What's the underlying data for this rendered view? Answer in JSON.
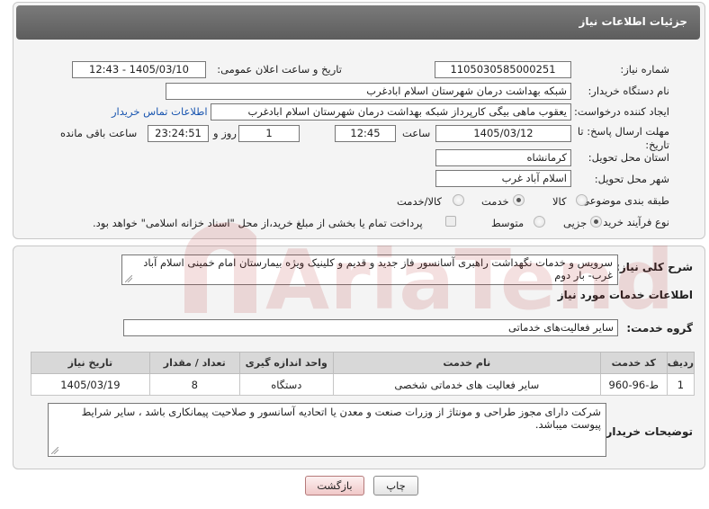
{
  "header": {
    "title": "جزئیات اطلاعات نیاز"
  },
  "fields": {
    "need_number_label": "شماره نیاز:",
    "need_number": "1105030585000251",
    "announce_datetime_label": "تاریخ و ساعت اعلان عمومی:",
    "announce_datetime": "1405/03/10 - 12:43",
    "buyer_org_label": "نام دستگاه خریدار:",
    "buyer_org": "شبکه بهداشت درمان شهرستان اسلام ابادغرب",
    "requester_label": "ایجاد کننده درخواست:",
    "requester": "یعقوب ماهی بیگی کارپرداز شبکه بهداشت درمان شهرستان اسلام ابادغرب",
    "contact_link": "اطلاعات تماس خریدار",
    "deadline_label": "مهلت ارسال پاسخ: تا تاریخ:",
    "deadline_date": "1405/03/12",
    "time_label": "ساعت",
    "deadline_time": "12:45",
    "days_value": "1",
    "days_label": "روز و",
    "remaining_time": "23:24:51",
    "remaining_label": "ساعت باقی مانده",
    "province_label": "استان محل تحویل:",
    "province": "کرمانشاه",
    "city_label": "شهر محل تحویل:",
    "city": "اسلام آباد غرب",
    "category_label": "طبقه بندی موضوعی:",
    "category_options": [
      "کالا",
      "خدمت",
      "کالا/خدمت"
    ],
    "category_selected": "خدمت",
    "process_label": "نوع فرآیند خرید :",
    "process_options": [
      "جزیی",
      "متوسط"
    ],
    "process_selected": "جزیی",
    "payment_note": "پرداخت تمام یا بخشی از مبلغ خرید،از محل \"اسناد خزانه اسلامی\" خواهد بود."
  },
  "need": {
    "summary_label": "شرح کلی نیاز:",
    "summary": "سرویس و خدمات نگهداشت راهبری آسانسور فاز جدید و قدیم و کلینیک ویژه بیمارستان امام خمینی اسلام آباد غرب- بار دوم",
    "services_title": "اطلاعات خدمات مورد نیاز",
    "service_group_label": "گروه خدمت:",
    "service_group": "سایر فعالیت‌های خدماتی"
  },
  "table": {
    "headers": [
      "ردیف",
      "کد خدمت",
      "نام خدمت",
      "واحد اندازه گیری",
      "تعداد / مقدار",
      "تاریخ نیاز"
    ],
    "rows": [
      [
        "1",
        "ط-96-960",
        "سایر فعالیت های خدماتی شخصی",
        "دستگاه",
        "8",
        "1405/03/19"
      ]
    ]
  },
  "buyer_notes": {
    "label": "توضیحات خریدار:",
    "text": "شرکت دارای مجوز طراحی و مونتاژ از وزرات صنعت و معدن یا اتحادیه آسانسور و صلاحیت پیمانکاری باشد ، سایر شرایط پیوست میباشد."
  },
  "buttons": {
    "print": "چاپ",
    "back": "بازگشت"
  },
  "watermark": {
    "text": "AriaTender.neT"
  }
}
